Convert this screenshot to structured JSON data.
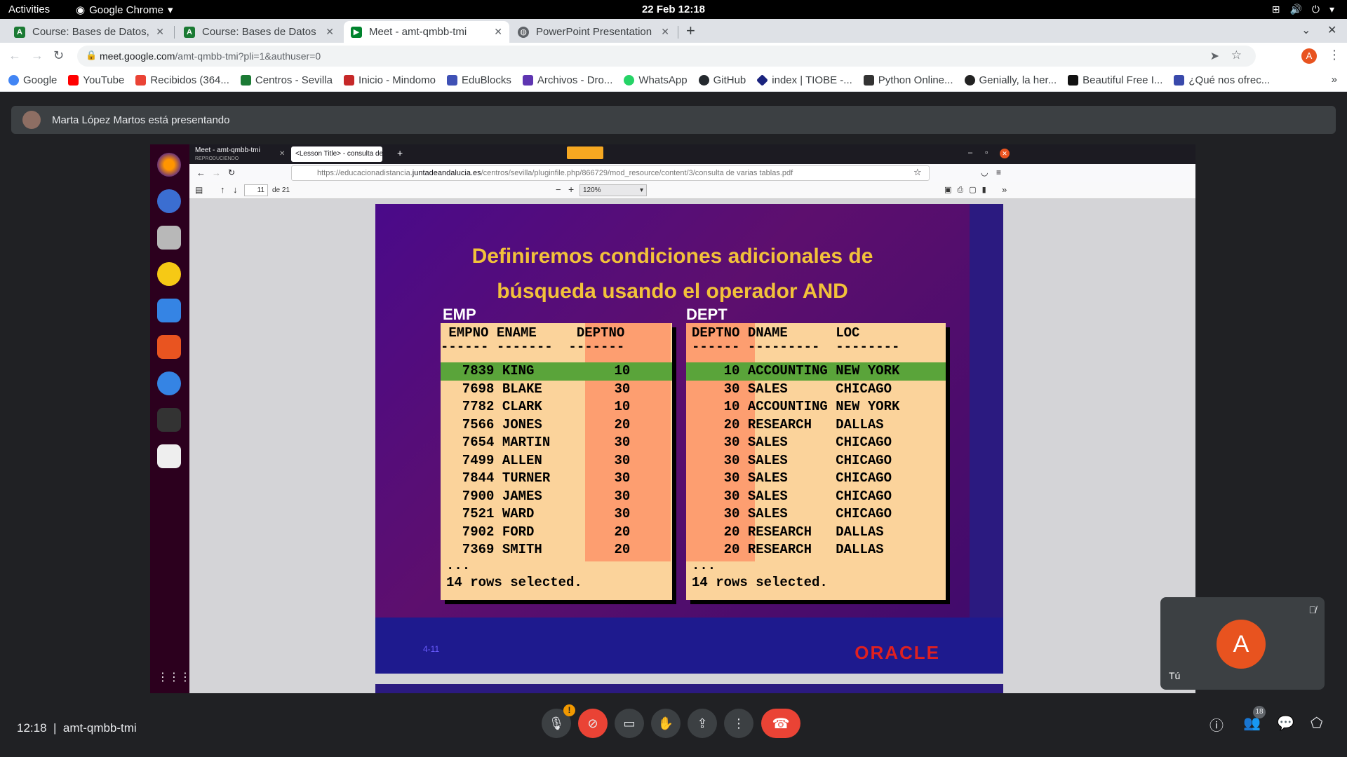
{
  "topbar": {
    "activities": "Activities",
    "app": "Google Chrome",
    "clock": "22 Feb 12:18"
  },
  "tabs": [
    {
      "title": "Course: Bases de Datos, T",
      "icon": "moodle-icon",
      "color": "#1b7a34"
    },
    {
      "title": "Course: Bases de Datos",
      "icon": "moodle-icon",
      "color": "#1b7a34"
    },
    {
      "title": "Meet - amt-qmbb-tmi",
      "icon": "meet-icon",
      "color": "#00832d"
    },
    {
      "title": "PowerPoint Presentation",
      "icon": "globe-icon",
      "color": "#5f6368"
    }
  ],
  "omnibox": {
    "host": "meet.google.com",
    "path": "/amt-qmbb-tmi?pli=1&authuser=0"
  },
  "profile_letter": "A",
  "bookmarks": [
    {
      "label": "Google",
      "color": "#4285f4"
    },
    {
      "label": "YouTube",
      "color": "#ff0000"
    },
    {
      "label": "Recibidos (364...",
      "color": "#ea4335"
    },
    {
      "label": "Centros - Sevilla",
      "color": "#1b7a34"
    },
    {
      "label": "Inicio - Mindomo",
      "color": "#c62828"
    },
    {
      "label": "EduBlocks",
      "color": "#3f51b5"
    },
    {
      "label": "Archivos - Dro...",
      "color": "#5e35b1"
    },
    {
      "label": "WhatsApp",
      "color": "#25d366"
    },
    {
      "label": "GitHub",
      "color": "#24292e"
    },
    {
      "label": "index | TIOBE -...",
      "color": "#1a237e"
    },
    {
      "label": "Python Online...",
      "color": "#333333"
    },
    {
      "label": "Genially, la her...",
      "color": "#222222"
    },
    {
      "label": "Beautiful Free I...",
      "color": "#111111"
    },
    {
      "label": "¿Qué nos ofrec...",
      "color": "#3949ab"
    }
  ],
  "presenter": {
    "text": "Marta López Martos está presentando"
  },
  "shared": {
    "ff_tab1": "Meet - amt-qmbb-tmi",
    "ff_tab1_sub": "REPRODUCIENDO",
    "ff_tab2": "<Lesson Title> - consulta de",
    "url_pre": "https://educacionadistancia.",
    "url_host": "juntadeandalucia.es",
    "url_path": "/centros/sevilla/pluginfile.php/866729/mod_resource/content/3/consulta de varias tablas.pdf",
    "page": "11",
    "of_pages": "de 21",
    "zoom": "120%",
    "slide_title_l1": "Definiremos condiciones adicionales de",
    "slide_title_l2": "búsqueda usando el operador AND",
    "emp_label": "EMP",
    "dept_label": "DEPT",
    "emp_header": " EMPNO ENAME     DEPTNO",
    "emp_dash": "------ -------  -------",
    "dept_header": "DEPTNO DNAME      LOC",
    "dept_dash": "------ ---------  --------",
    "emp_rows": [
      "  7839 KING          10",
      "  7698 BLAKE         30",
      "  7782 CLARK         10",
      "  7566 JONES         20",
      "  7654 MARTIN        30",
      "  7499 ALLEN         30",
      "  7844 TURNER        30",
      "  7900 JAMES         30",
      "  7521 WARD          30",
      "  7902 FORD          20",
      "  7369 SMITH         20"
    ],
    "dept_rows": [
      "    10 ACCOUNTING NEW YORK",
      "    30 SALES      CHICAGO",
      "    10 ACCOUNTING NEW YORK",
      "    20 RESEARCH   DALLAS",
      "    30 SALES      CHICAGO",
      "    30 SALES      CHICAGO",
      "    30 SALES      CHICAGO",
      "    30 SALES      CHICAGO",
      "    30 SALES      CHICAGO",
      "    20 RESEARCH   DALLAS",
      "    20 RESEARCH   DALLAS"
    ],
    "ellipsis": "...",
    "rows_selected": "14 rows selected.",
    "slide_no": "4-11",
    "oracle": "ORACLE"
  },
  "self_tile": {
    "letter": "A",
    "name": "Tú"
  },
  "meeting": {
    "time": "12:18",
    "code": "amt-qmbb-tmi",
    "participants": "18"
  }
}
